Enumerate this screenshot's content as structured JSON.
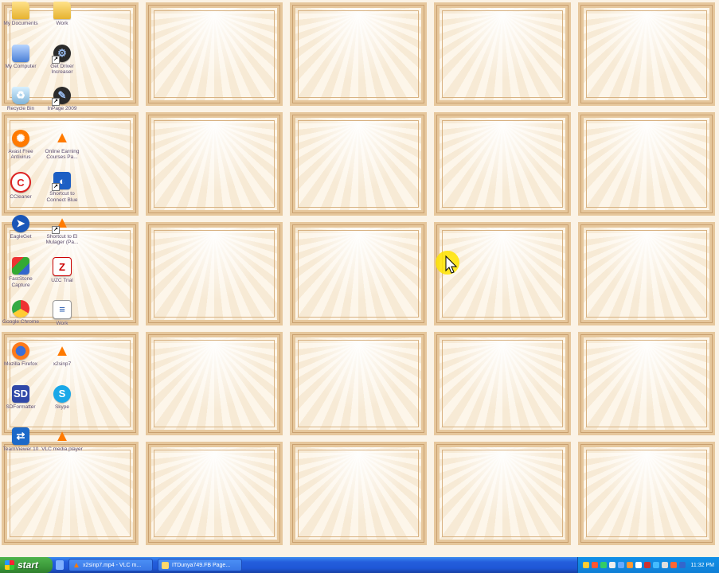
{
  "desktop": {
    "icons": [
      {
        "label": "My Documents",
        "icon": "my-documents-icon",
        "style": "folder",
        "glyph": "",
        "shortcut": false
      },
      {
        "label": "Work",
        "icon": "folder-icon",
        "style": "folder",
        "glyph": "",
        "shortcut": false
      },
      {
        "label": "My Computer",
        "icon": "my-computer-icon",
        "style": "computer",
        "glyph": "",
        "shortcut": false
      },
      {
        "label": "Get Driver Increaser",
        "icon": "driver-icon",
        "style": "gear",
        "glyph": "⚙",
        "shortcut": true
      },
      {
        "label": "Recycle Bin",
        "icon": "recycle-bin-icon",
        "style": "bin",
        "glyph": "♻",
        "shortcut": false
      },
      {
        "label": "InPage 2009",
        "icon": "inpage-icon",
        "style": "gear",
        "glyph": "✎",
        "shortcut": true
      },
      {
        "label": "Avast Free Antivirus",
        "icon": "avast-icon",
        "style": "avast",
        "glyph": "✺",
        "shortcut": false
      },
      {
        "label": "Online Earning Courses Pa...",
        "icon": "vlc-cone-icon",
        "style": "cone",
        "glyph": "▲",
        "shortcut": false
      },
      {
        "label": "CCleaner",
        "icon": "ccleaner-icon",
        "style": "ccleaner",
        "glyph": "C",
        "shortcut": false
      },
      {
        "label": "Shortcut to Connect Blue",
        "icon": "connect-blue-icon",
        "style": "connect",
        "glyph": "◐",
        "shortcut": true
      },
      {
        "label": "EagleGet",
        "icon": "eagleget-icon",
        "style": "eagle",
        "glyph": "➤",
        "shortcut": false
      },
      {
        "label": "Shortcut to El Mulager (Pa...",
        "icon": "vlc-cone-icon",
        "style": "cone",
        "glyph": "▲",
        "shortcut": true
      },
      {
        "label": "FastStone Capture",
        "icon": "faststone-icon",
        "style": "fastone",
        "glyph": "",
        "shortcut": false
      },
      {
        "label": "UZC Trial",
        "icon": "uzc-icon",
        "style": "uzc",
        "glyph": "Z",
        "shortcut": false
      },
      {
        "label": "Google Chrome",
        "icon": "chrome-icon",
        "style": "chrome",
        "glyph": "",
        "shortcut": false
      },
      {
        "label": "Work",
        "icon": "word-document-icon",
        "style": "word",
        "glyph": "≡",
        "shortcut": false
      },
      {
        "label": "Mozilla Firefox",
        "icon": "firefox-icon",
        "style": "firefox",
        "glyph": "",
        "shortcut": false
      },
      {
        "label": "x2sinp7",
        "icon": "vlc-cone-icon",
        "style": "cone",
        "glyph": "▲",
        "shortcut": false
      },
      {
        "label": "SDFormatter",
        "icon": "sdformatter-icon",
        "style": "sd",
        "glyph": "SD",
        "shortcut": false
      },
      {
        "label": "Skype",
        "icon": "skype-icon",
        "style": "skype",
        "glyph": "S",
        "shortcut": false
      },
      {
        "label": "TeamViewer 10",
        "icon": "teamviewer-icon",
        "style": "teamviewer",
        "glyph": "⇄",
        "shortcut": false
      },
      {
        "label": "VLC media player",
        "icon": "vlc-icon",
        "style": "vlc",
        "glyph": "▲",
        "shortcut": false
      }
    ]
  },
  "taskbar": {
    "start_label": "start",
    "tasks": [
      {
        "label": "x2sinp7.mp4 - VLC m...",
        "kind": "vlc"
      },
      {
        "label": "ITDunya749.FB Page...",
        "kind": "ie"
      }
    ],
    "tray_colors": [
      "#ffcc33",
      "#ff5533",
      "#33cc66",
      "#eeeeee",
      "#66aaff",
      "#ff9933",
      "#ffffff",
      "#cc3333",
      "#44bbff",
      "#dddddd",
      "#ff6633",
      "#3366cc"
    ],
    "clock": "11:32 PM"
  },
  "colors": {
    "taskbar_blue": "#245edc",
    "start_green": "#3c9a3b",
    "certificate_border": "#e6c79c"
  }
}
